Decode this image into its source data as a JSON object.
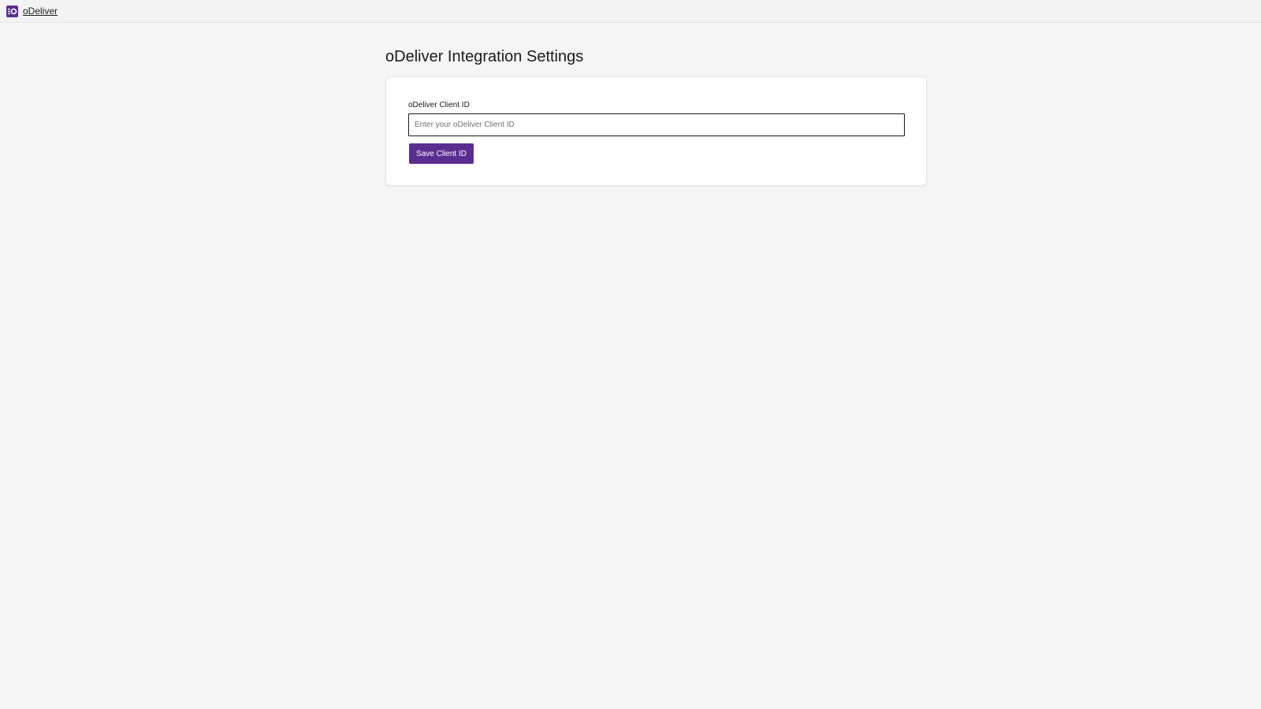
{
  "header": {
    "brand_name": "oDeliver",
    "brand_icon": "odeliver-logo-icon",
    "brand_color": "#5c2d91"
  },
  "main": {
    "title": "oDeliver Integration Settings",
    "client_id_field": {
      "label": "oDeliver Client ID",
      "placeholder": "Enter your oDeliver Client ID",
      "value": ""
    },
    "save_button_label": "Save Client ID"
  },
  "colors": {
    "accent": "#5c2d91",
    "background": "#f5f5f5",
    "card": "#ffffff"
  }
}
